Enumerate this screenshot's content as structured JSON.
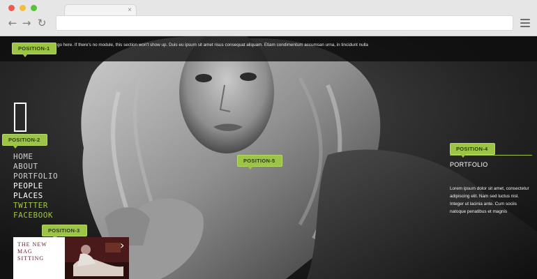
{
  "browser": {
    "tab_close": "×",
    "nav_back": "←",
    "nav_forward": "→",
    "nav_reload": "↻"
  },
  "positions": {
    "pos1": "POSITION-1",
    "pos2": "POSITION-2",
    "pos3": "POSITION-3",
    "pos4": "POSITION-4",
    "pos5": "POSITION-5"
  },
  "topbar": {
    "text": "Position-1 module can go here. If there's no module, this section won't show up. Duis eu ipsum sit amet risus consequat aliquam. Etiam condimentum accumsan urna, in tincidunt nulla placerat ut"
  },
  "nav": {
    "items": [
      "HOME",
      "ABOUT",
      "PORTFOLIO",
      "PEOPLE",
      "PLACES",
      "TWITTER",
      "FACEBOOK"
    ]
  },
  "sidebar": {
    "title": "PORTFOLIO",
    "body": "Lorem ipsum dolor sit amet, consectetur adipiscing elit. Nam sed luctus nisl. Integer ut lacinia ante. Cum sociis natoque penatibus et magnis"
  },
  "feature": {
    "title": "THE NEW\nMAG\nSITTING",
    "arrow": "›"
  },
  "colors": {
    "accent": "#9dc545",
    "chrome": "#e6e6e6"
  }
}
